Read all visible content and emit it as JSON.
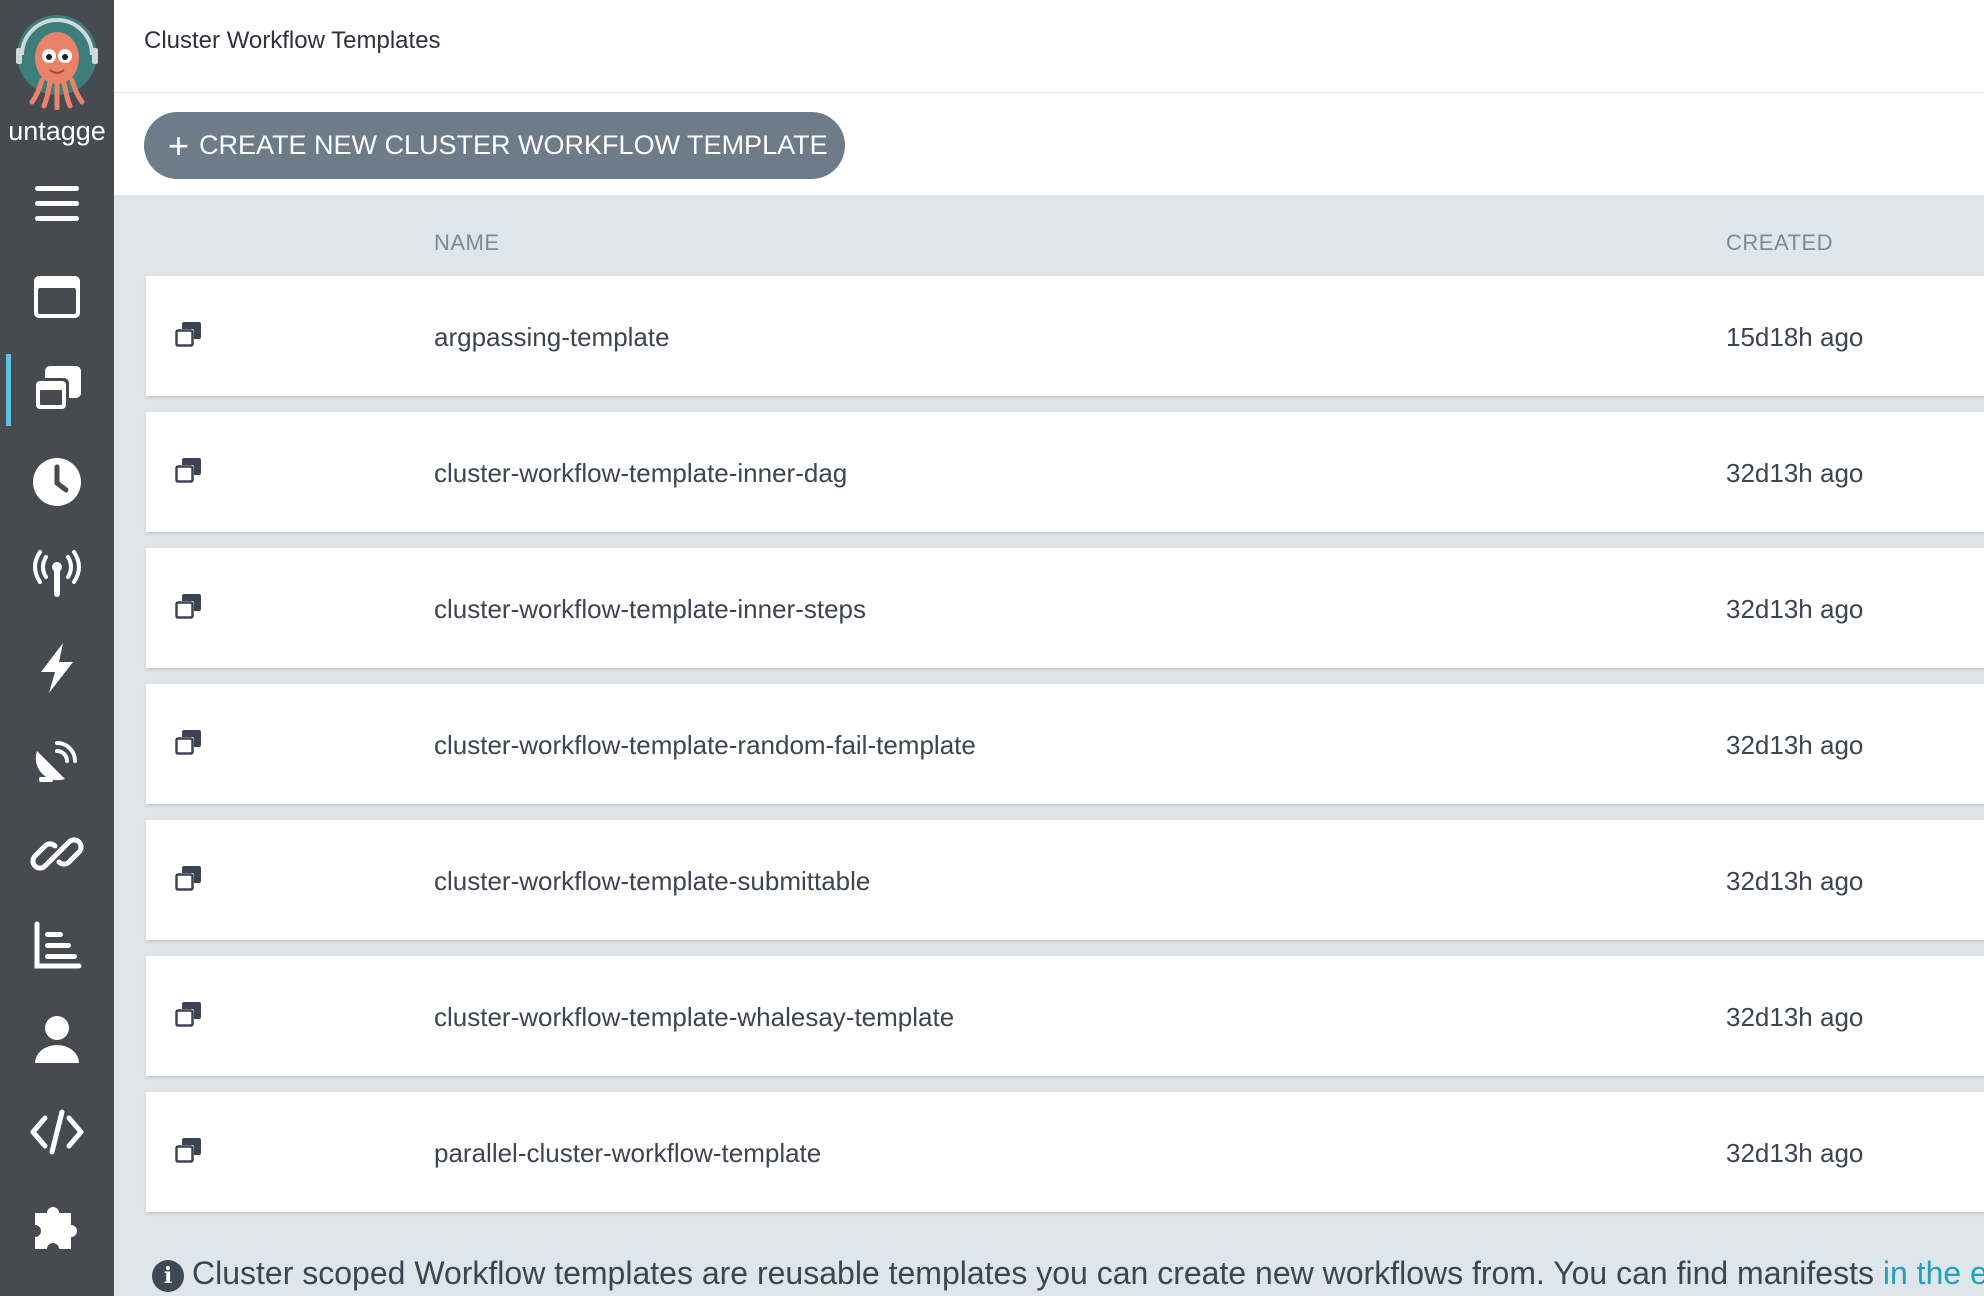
{
  "sidebar": {
    "brand_name": "untagge",
    "items": [
      {
        "name": "menu-toggle",
        "icon": "hamburger-icon"
      },
      {
        "name": "workflows",
        "icon": "window-icon"
      },
      {
        "name": "cluster-workflow-templates",
        "icon": "window-restore-icon",
        "active": true
      },
      {
        "name": "cron-workflows",
        "icon": "clock-icon"
      },
      {
        "name": "event-sources",
        "icon": "broadcast-tower-icon"
      },
      {
        "name": "sensors",
        "icon": "bolt-icon"
      },
      {
        "name": "event-flow",
        "icon": "satellite-dish-icon"
      },
      {
        "name": "links",
        "icon": "link-icon"
      },
      {
        "name": "reports",
        "icon": "chart-bar-icon"
      },
      {
        "name": "user-info",
        "icon": "user-icon"
      },
      {
        "name": "api-docs",
        "icon": "code-icon"
      },
      {
        "name": "plugins",
        "icon": "puzzle-piece-icon"
      }
    ]
  },
  "header": {
    "title": "Cluster Workflow Templates"
  },
  "toolbar": {
    "create_icon": "+",
    "create_label": "CREATE NEW CLUSTER WORKFLOW TEMPLATE"
  },
  "table": {
    "columns": {
      "name": "NAME",
      "created": "CREATED"
    },
    "rows": [
      {
        "name": "argpassing-template",
        "created": "15d18h ago"
      },
      {
        "name": "cluster-workflow-template-inner-dag",
        "created": "32d13h ago"
      },
      {
        "name": "cluster-workflow-template-inner-steps",
        "created": "32d13h ago"
      },
      {
        "name": "cluster-workflow-template-random-fail-template",
        "created": "32d13h ago"
      },
      {
        "name": "cluster-workflow-template-submittable",
        "created": "32d13h ago"
      },
      {
        "name": "cluster-workflow-template-whalesay-template",
        "created": "32d13h ago"
      },
      {
        "name": "parallel-cluster-workflow-template",
        "created": "32d13h ago"
      }
    ]
  },
  "footer": {
    "info_icon": "i",
    "info_text": "Cluster scoped Workflow templates are reusable templates you can create new workflows from. You can find manifests ",
    "info_link": "in the e"
  },
  "colors": {
    "sidebar_bg": "#474a4e",
    "active_indicator": "#61c2e0",
    "button_bg": "#6d7c88",
    "page_bg": "#dee6eb",
    "link": "#1fa3b8"
  }
}
